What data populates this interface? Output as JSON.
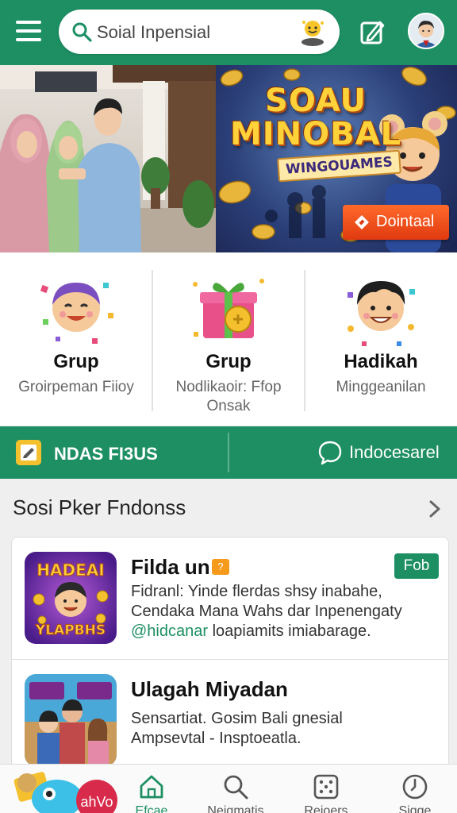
{
  "header": {
    "search_text": "Soial Inpensial"
  },
  "banner": {
    "promo_title_line1": "SOAU",
    "promo_title_line2": "MINOBAL",
    "promo_subtitle": "WINGOUAMES",
    "donate_label": "Dointaal"
  },
  "categories": [
    {
      "title": "Grup",
      "subtitle": "Groirpeman Fiioy"
    },
    {
      "title": "Grup",
      "subtitle": "Nodlikaoir: Ffop Onsak"
    },
    {
      "title": "Hadikah",
      "subtitle": "Minggeanilan"
    }
  ],
  "action_bar": {
    "left_label": "NDAS FI3US",
    "right_label": "Indocesarel"
  },
  "section": {
    "title": "Sosi Pker Fndonss"
  },
  "cards": [
    {
      "title": "Filda un",
      "badge": "?",
      "description_line1": "Fidranl: Yinde flerdas shsy inabahe,",
      "description_line2": "Cendaka Mana Wahs dar Inpenengaty",
      "link": "@hidcanar",
      "description_line3": " loapiamits imiabarage.",
      "button": "Fob",
      "thumb_text_top": "HADEAI",
      "thumb_text_bottom": "YLAPBHS"
    },
    {
      "title": "Ulagah Miyadan",
      "description_line1": "Sensartiat. Gosim Bali gnesial",
      "description_line2": "Ampsevtal - Insptoeatla."
    }
  ],
  "bottom_nav": [
    {
      "label": "Efcae",
      "icon": "home-icon",
      "active": true
    },
    {
      "label": "Neigmatis",
      "icon": "search-icon",
      "active": false
    },
    {
      "label": "Rejoers",
      "icon": "dice-icon",
      "active": false
    },
    {
      "label": "Sigge",
      "icon": "clock-icon",
      "active": false
    }
  ],
  "mascot_text": "ahVo",
  "colors": {
    "primary": "#1d8f63",
    "accent": "#e03a10",
    "badge": "#f59a1a"
  }
}
